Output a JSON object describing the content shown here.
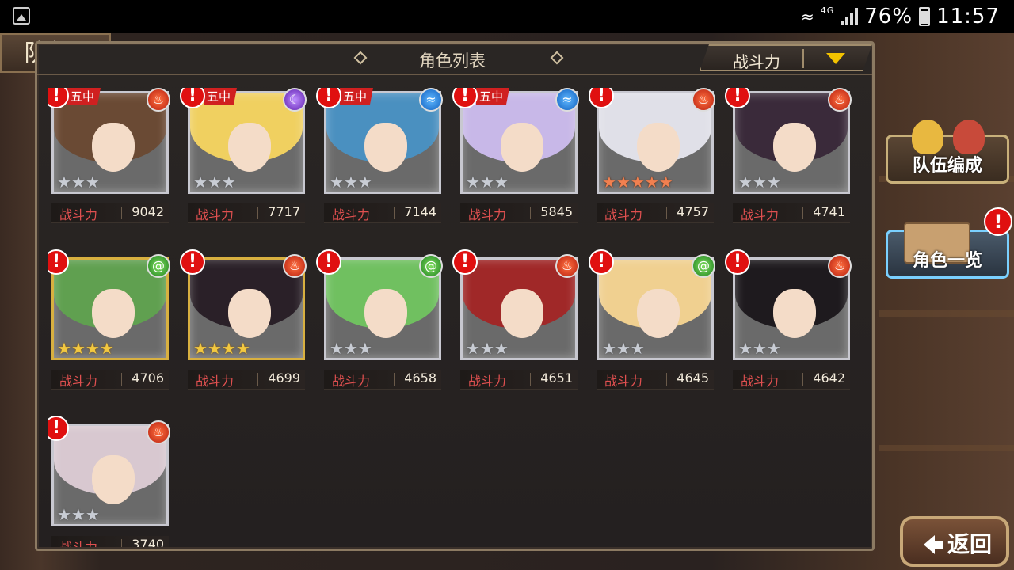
{
  "status_bar": {
    "network": "4G",
    "battery": "76%",
    "time": "11:57"
  },
  "title_tab": "队伍",
  "panel": {
    "title": "角色列表",
    "sort_label": "战斗力"
  },
  "power_label": "战斗力",
  "team_tag": "五中",
  "alert_mark": "!",
  "characters": [
    {
      "power": "9042",
      "element": "fire",
      "stars": 3,
      "star_type": "silver",
      "in_team": true,
      "hair": "#6a4a34"
    },
    {
      "power": "7717",
      "element": "moon",
      "stars": 3,
      "star_type": "silver",
      "in_team": true,
      "hair": "#f0d060"
    },
    {
      "power": "7144",
      "element": "water",
      "stars": 3,
      "star_type": "silver",
      "in_team": true,
      "hair": "#4a90c0"
    },
    {
      "power": "5845",
      "element": "water",
      "stars": 3,
      "star_type": "silver",
      "in_team": true,
      "hair": "#c8b8e8"
    },
    {
      "power": "4757",
      "element": "fire",
      "stars": 5,
      "star_type": "rainbow",
      "in_team": false,
      "hair": "#e0e0e8"
    },
    {
      "power": "4741",
      "element": "fire",
      "stars": 3,
      "star_type": "silver",
      "in_team": false,
      "hair": "#3a2a3a"
    },
    {
      "power": "4706",
      "element": "wind",
      "stars": 4,
      "star_type": "gold",
      "in_team": false,
      "hair": "#60a050"
    },
    {
      "power": "4699",
      "element": "fire",
      "stars": 4,
      "star_type": "gold",
      "in_team": false,
      "hair": "#2a2028"
    },
    {
      "power": "4658",
      "element": "wind",
      "stars": 3,
      "star_type": "silver",
      "in_team": false,
      "hair": "#70c060"
    },
    {
      "power": "4651",
      "element": "fire",
      "stars": 3,
      "star_type": "silver",
      "in_team": false,
      "hair": "#a02828"
    },
    {
      "power": "4645",
      "element": "wind",
      "stars": 3,
      "star_type": "silver",
      "in_team": false,
      "hair": "#f0d090"
    },
    {
      "power": "4642",
      "element": "fire",
      "stars": 3,
      "star_type": "silver",
      "in_team": false,
      "hair": "#1e1a1e"
    },
    {
      "power": "3740",
      "element": "fire",
      "stars": 3,
      "star_type": "silver",
      "in_team": false,
      "hair": "#d8c8d0"
    }
  ],
  "side_menu": {
    "team_edit": "队伍编成",
    "character_list": "角色一览"
  },
  "back_button": "返回",
  "colors": {
    "alert": "#e01010",
    "power_label": "#e05050",
    "sort_arrow": "#f2c200",
    "panel_border": "#8c7a62"
  }
}
